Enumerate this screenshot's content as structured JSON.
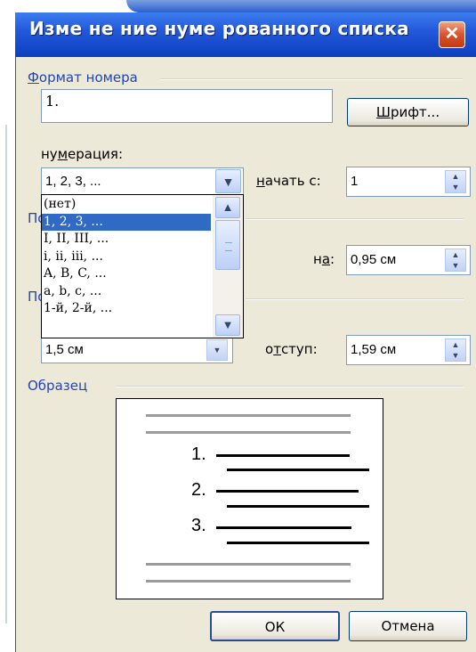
{
  "dialog": {
    "title": "Изме не ние нуме рованного списка",
    "close_symbol": "✕"
  },
  "number_format": {
    "group_label": "Формат номера",
    "format_value": "1.",
    "font_button": "Шрифт..."
  },
  "numbering": {
    "label": "нумерация:",
    "selected": "1, 2, 3, ...",
    "start_label": "начать с:",
    "start_value": "1",
    "options": [
      "(нет)",
      "1, 2, 3, ...",
      "I, II, III, ...",
      "i, ii, iii, ...",
      "A, B, C, ...",
      "a, b, c, ...",
      "1-й, 2-й, ..."
    ],
    "selected_index": 1
  },
  "position": {
    "group_label_partial": "По",
    "at_label": "на:",
    "at_value": "0,95 см"
  },
  "text_position": {
    "group_label_partial": "По",
    "tab_value": "1,5 см",
    "indent_label": "отступ:",
    "indent_value": "1,59 см"
  },
  "preview": {
    "group_label": "Образец",
    "numbers": [
      "1.",
      "2.",
      "3."
    ]
  },
  "buttons": {
    "ok": "ОК",
    "cancel": "Отмена"
  },
  "colors": {
    "titlebar": "#0c3fbe",
    "selection": "#316ac5",
    "dialog_bg": "#ece9d8",
    "group_label": "#1f45b8"
  }
}
